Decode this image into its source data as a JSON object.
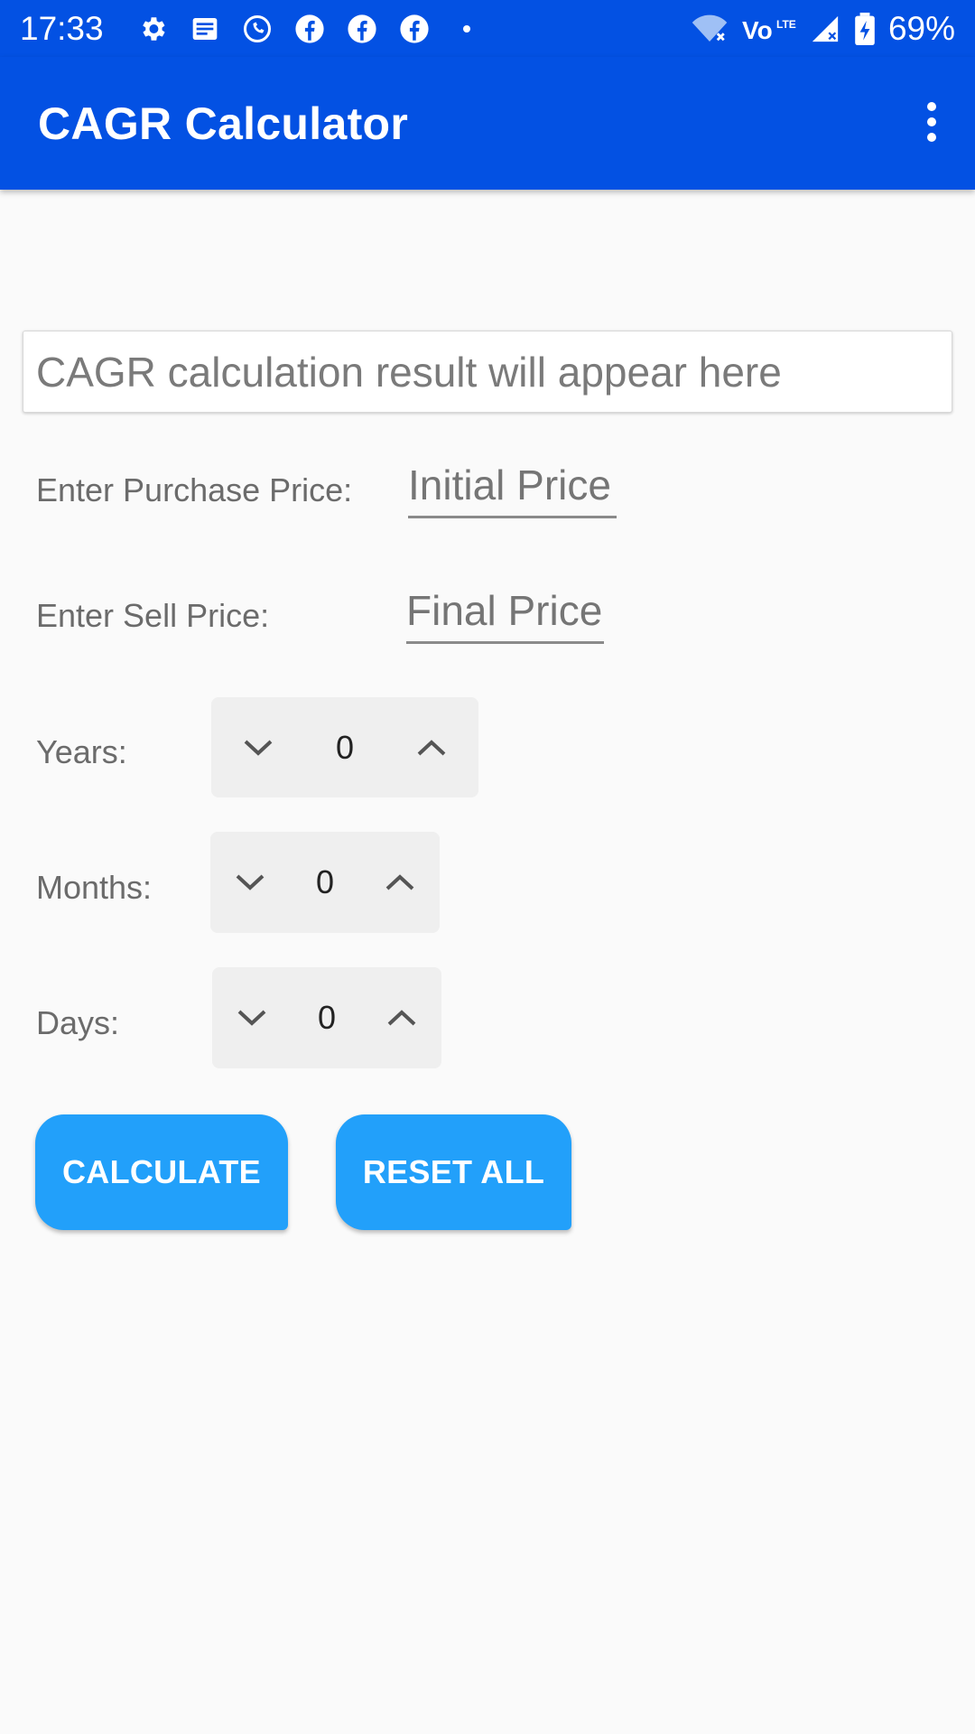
{
  "status_bar": {
    "time": "17:33",
    "battery": "69%",
    "left_icons": [
      "gear-icon",
      "message-icon",
      "whatsapp-icon",
      "facebook-icon",
      "facebook-icon",
      "facebook-icon",
      "dot-icon"
    ],
    "right_icons": [
      "wifi-icon",
      "volte-icon",
      "signal-icon",
      "battery-icon"
    ]
  },
  "app_bar": {
    "title": "CAGR Calculator",
    "overflow_icon": "more-vert-icon"
  },
  "result": {
    "placeholder": "CAGR calculation result will appear here"
  },
  "form": {
    "purchase": {
      "label": "Enter Purchase Price:",
      "placeholder": "Initial Price",
      "value": ""
    },
    "sell": {
      "label": "Enter Sell Price:",
      "placeholder": "Final Price",
      "value": ""
    },
    "years": {
      "label": "Years:",
      "value": "0"
    },
    "months": {
      "label": "Months:",
      "value": "0"
    },
    "days": {
      "label": "Days:",
      "value": "0"
    }
  },
  "buttons": {
    "calculate": "CALCULATE",
    "reset": "RESET ALL"
  },
  "colors": {
    "primary": "#0351e3",
    "accent": "#22a0fa",
    "background": "#fafafa"
  }
}
